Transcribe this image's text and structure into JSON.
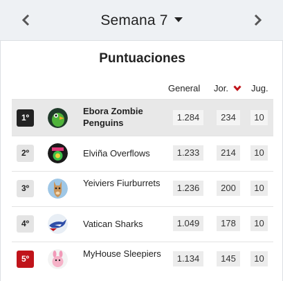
{
  "header": {
    "prev_icon": "chevron-left-icon",
    "title": "Semana 7",
    "dropdown_icon": "caret-down-icon",
    "next_icon": "chevron-right-icon"
  },
  "card": {
    "title": "Puntuaciones",
    "columns": {
      "general": "General",
      "jor": "Jor.",
      "jor_sort_icon": "chevron-down-icon",
      "jug": "Jug."
    }
  },
  "colors": {
    "accent_red": "#c0141a",
    "dark_badge": "#222222",
    "row_highlight": "#e8e8e8"
  },
  "rows": [
    {
      "rank": "1º",
      "rank_style": "dark",
      "team": "Ebora Zombie Penguins",
      "general": "1.284",
      "jor": "234",
      "jug": "10",
      "avatar": "green-parrot-avatar",
      "highlight": true
    },
    {
      "rank": "2º",
      "rank_style": "light",
      "team": "Elviña Overflows",
      "general": "1.233",
      "jor": "214",
      "jug": "10",
      "avatar": "overflows-logo-avatar",
      "highlight": false
    },
    {
      "rank": "3º",
      "rank_style": "light",
      "team": "Yeiviers Fiurburrets",
      "general": "1.236",
      "jor": "200",
      "jug": "10",
      "avatar": "llama-avatar",
      "highlight": false
    },
    {
      "rank": "4º",
      "rank_style": "light",
      "team": "Vatican Sharks",
      "general": "1.049",
      "jor": "178",
      "jug": "10",
      "avatar": "shark-avatar",
      "highlight": false
    },
    {
      "rank": "5º",
      "rank_style": "red",
      "team": "MyHouse Sleepiers",
      "general": "1.134",
      "jor": "145",
      "jug": "10",
      "avatar": "pink-creature-avatar",
      "highlight": false
    }
  ]
}
